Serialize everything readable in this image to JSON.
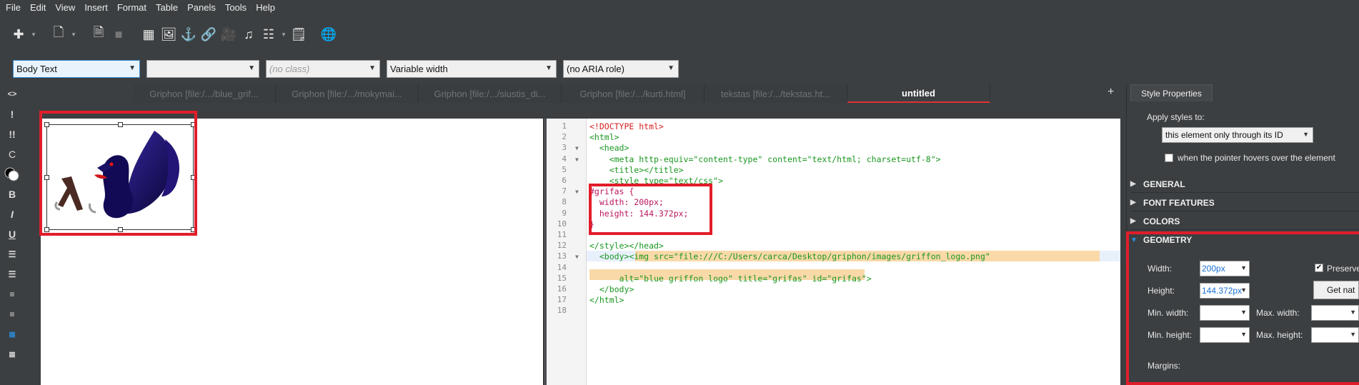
{
  "menu": [
    {
      "label": "File"
    },
    {
      "label": "Edit"
    },
    {
      "label": "View"
    },
    {
      "label": "Insert"
    },
    {
      "label": "Format"
    },
    {
      "label": "Table"
    },
    {
      "label": "Panels"
    },
    {
      "label": "Tools"
    },
    {
      "label": "Help"
    }
  ],
  "formatbar": {
    "paragraph_style": "Body Text",
    "second": "",
    "class_placeholder": "(no class)",
    "width_mode": "Variable width",
    "aria_role": "(no ARIA role)"
  },
  "tabs": [
    {
      "label": "Griphon [file:/.../blue_grif..."
    },
    {
      "label": "Griphon [file:/.../mokymai..."
    },
    {
      "label": "Griphon [file:/.../siustis_di..."
    },
    {
      "label": "Griphon [file:/.../kurti.html]"
    },
    {
      "label": "tekstas [file:/.../tekstas.ht..."
    },
    {
      "label": "untitled"
    }
  ],
  "tab_add": "+",
  "source_lines": [
    {
      "n": "1",
      "text": "<!DOCTYPE html>"
    },
    {
      "n": "2",
      "text": "<html>"
    },
    {
      "n": "3",
      "text": "  <head>"
    },
    {
      "n": "4",
      "text": "    <meta http-equiv=\"content-type\" content=\"text/html; charset=utf-8\">"
    },
    {
      "n": "5",
      "text": "    <title></title>"
    },
    {
      "n": "6",
      "text": "    <style type=\"text/css\">"
    },
    {
      "n": "7",
      "text": "#grifas {"
    },
    {
      "n": "8",
      "text": "  width: 200px;"
    },
    {
      "n": "9",
      "text": "  height: 144.372px;"
    },
    {
      "n": "10",
      "text": "}"
    },
    {
      "n": "11",
      "text": ""
    },
    {
      "n": "12",
      "text": "</style></head>"
    },
    {
      "n": "13",
      "text": "  <body><img src=\"file:///C:/Users/carca/Desktop/griphon/images/griffon_logo.png\""
    },
    {
      "n": "14",
      "text": ""
    },
    {
      "n": "15",
      "text": "      alt=\"blue griffon logo\" title=\"grifas\" id=\"grifas\">"
    },
    {
      "n": "16",
      "text": "  </body>"
    },
    {
      "n": "17",
      "text": "</html>"
    },
    {
      "n": "18",
      "text": ""
    }
  ],
  "panel": {
    "tab": "Style Properties",
    "apply_label": "Apply styles to:",
    "apply_value": "this element only through its ID",
    "hover_label": "when the pointer hovers over the element",
    "sections": [
      "GENERAL",
      "FONT FEATURES",
      "COLORS",
      "GEOMETRY"
    ],
    "width_label": "Width:",
    "width_value": "200px",
    "height_label": "Height:",
    "height_value": "144.372px",
    "preserve_label": "Preserve",
    "get_natural": "Get nat",
    "min_width": "Min. width:",
    "max_width": "Max. width:",
    "min_height": "Min. height:",
    "max_height": "Max. height:",
    "margins": "Margins:"
  },
  "colors": {
    "accent_red": "#e11d2a",
    "link_blue": "#1a6fd4",
    "ui_dark": "#3c3f41"
  }
}
